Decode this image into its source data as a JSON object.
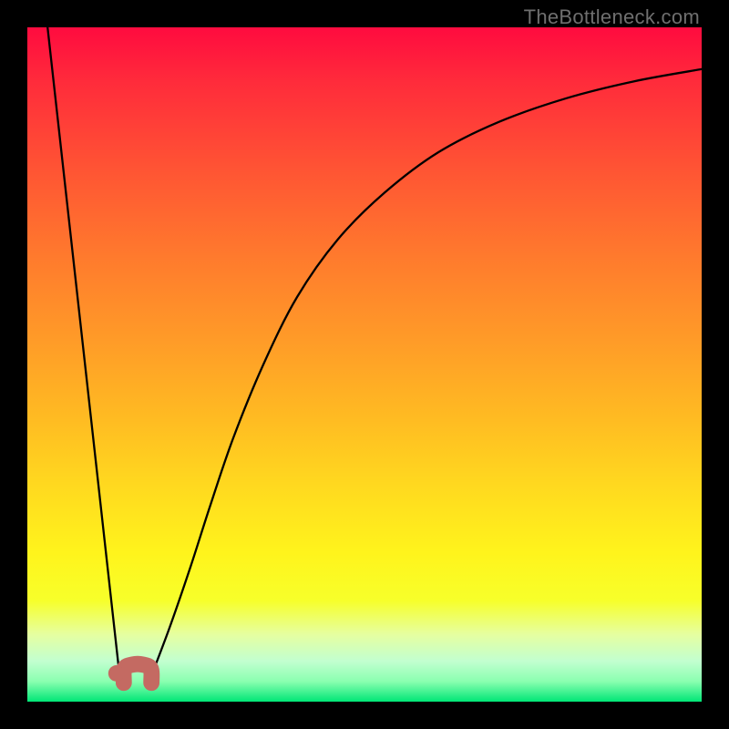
{
  "watermark": {
    "text": "TheBottleneck.com"
  },
  "chart_data": {
    "type": "line",
    "title": "",
    "xlabel": "",
    "ylabel": "",
    "xlim": [
      0,
      100
    ],
    "ylim": [
      0,
      100
    ],
    "series": [
      {
        "name": "left-slope",
        "x": [
          3.0,
          13.8
        ],
        "values": [
          100.0,
          2.8
        ]
      },
      {
        "name": "right-curve",
        "x": [
          18.0,
          21.1,
          24.2,
          27.1,
          30.5,
          35.0,
          40.0,
          46.0,
          53.0,
          61.0,
          70.0,
          80.0,
          90.0,
          100.0
        ],
        "values": [
          2.8,
          11.0,
          20.0,
          29.0,
          39.0,
          50.0,
          60.0,
          68.5,
          75.5,
          81.5,
          86.0,
          89.5,
          92.0,
          93.8
        ]
      }
    ],
    "markers": [
      {
        "name": "dot",
        "x": 13.2,
        "y": 4.2,
        "r": 1.2,
        "color": "#c46a62"
      },
      {
        "name": "j-shape",
        "color": "#c46a62",
        "path_xy": [
          [
            14.3,
            2.8
          ],
          [
            14.4,
            4.9
          ],
          [
            15.6,
            5.5
          ],
          [
            17.1,
            5.5
          ],
          [
            18.3,
            4.9
          ],
          [
            18.4,
            2.8
          ]
        ],
        "stroke_w": 2.4
      }
    ],
    "background": {
      "gradient_stops": [
        {
          "pos": 0.0,
          "color": "#ff0b3f"
        },
        {
          "pos": 0.22,
          "color": "#ff5733"
        },
        {
          "pos": 0.46,
          "color": "#ff9a28"
        },
        {
          "pos": 0.68,
          "color": "#ffd91f"
        },
        {
          "pos": 0.85,
          "color": "#f7ff2a"
        },
        {
          "pos": 1.0,
          "color": "#00e676"
        }
      ]
    }
  }
}
